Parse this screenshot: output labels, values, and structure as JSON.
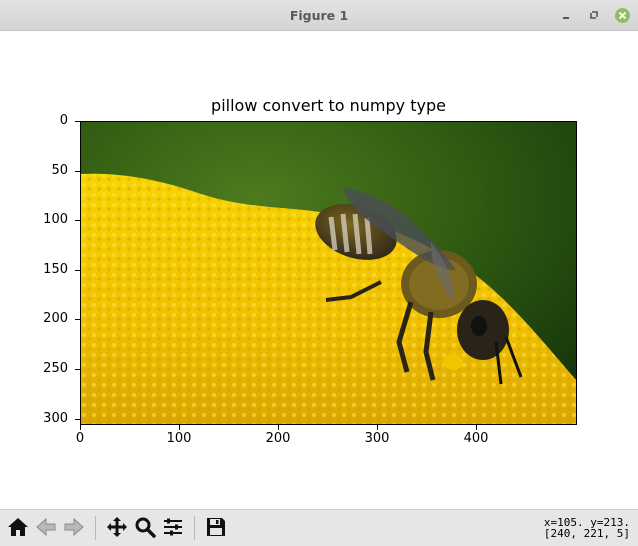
{
  "window": {
    "title": "Figure 1"
  },
  "figure": {
    "title": "pillow convert to numpy type",
    "image_description_icon": "bee-on-yellow-flower-image",
    "xticks": [
      "0",
      "100",
      "200",
      "300",
      "400"
    ],
    "yticks": [
      "0",
      "50",
      "100",
      "150",
      "200",
      "250",
      "300"
    ],
    "colors": {
      "flower_yellow": "#f2c600",
      "background_green": "#2f5a12",
      "bee_dark": "#2a2418"
    }
  },
  "toolbar": {
    "buttons": [
      {
        "name": "home-button",
        "icon": "home-icon"
      },
      {
        "name": "back-button",
        "icon": "arrow-left-icon"
      },
      {
        "name": "forward-button",
        "icon": "arrow-right-icon"
      },
      {
        "name": "pan-button",
        "icon": "move-arrows-icon"
      },
      {
        "name": "zoom-button",
        "icon": "magnifier-icon"
      },
      {
        "name": "configure-subplots-button",
        "icon": "sliders-icon"
      },
      {
        "name": "save-button",
        "icon": "floppy-disk-icon"
      }
    ],
    "coords_line1": "x=105. y=213.",
    "coords_line2": "[240, 221, 5]"
  }
}
